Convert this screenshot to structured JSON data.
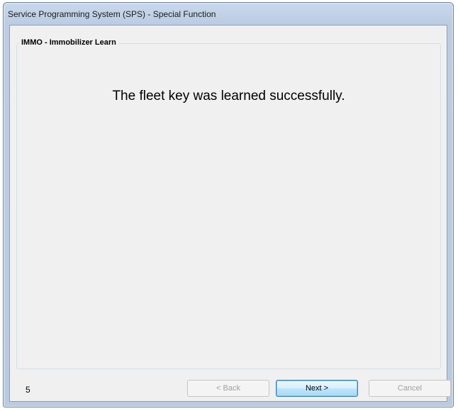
{
  "window": {
    "title": "Service Programming System (SPS) - Special Function"
  },
  "group": {
    "label": "IMMO - Immobilizer Learn"
  },
  "main": {
    "message": "The fleet key was learned successfully."
  },
  "footer": {
    "step_number": "5",
    "back_label": "< Back",
    "next_label": "Next >",
    "cancel_label": "Cancel"
  },
  "colors": {
    "titlebar": "#bccde3",
    "client_background": "#f0f0f0",
    "default_button_accent": "#3c7fb1"
  }
}
